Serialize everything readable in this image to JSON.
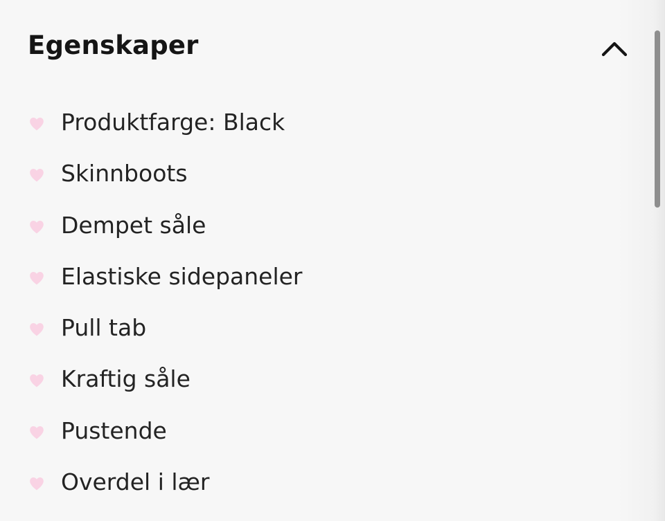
{
  "section": {
    "title": "Egenskaper",
    "expanded": true,
    "toggle_icon": "chevron-up-icon"
  },
  "features": [
    {
      "label": "Produktfarge: Black",
      "icon": "heart-icon"
    },
    {
      "label": "Skinnboots",
      "icon": "heart-icon"
    },
    {
      "label": "Dempet såle",
      "icon": "heart-icon"
    },
    {
      "label": "Elastiske sidepaneler",
      "icon": "heart-icon"
    },
    {
      "label": "Pull tab",
      "icon": "heart-icon"
    },
    {
      "label": "Kraftig såle",
      "icon": "heart-icon"
    },
    {
      "label": "Pustende",
      "icon": "heart-icon"
    },
    {
      "label": "Overdel i lær",
      "icon": "heart-icon"
    }
  ],
  "colors": {
    "heart": "#f9d3e4",
    "text": "#232323",
    "background": "#f7f7f7",
    "scrollbar_thumb": "#8e8e8e"
  }
}
